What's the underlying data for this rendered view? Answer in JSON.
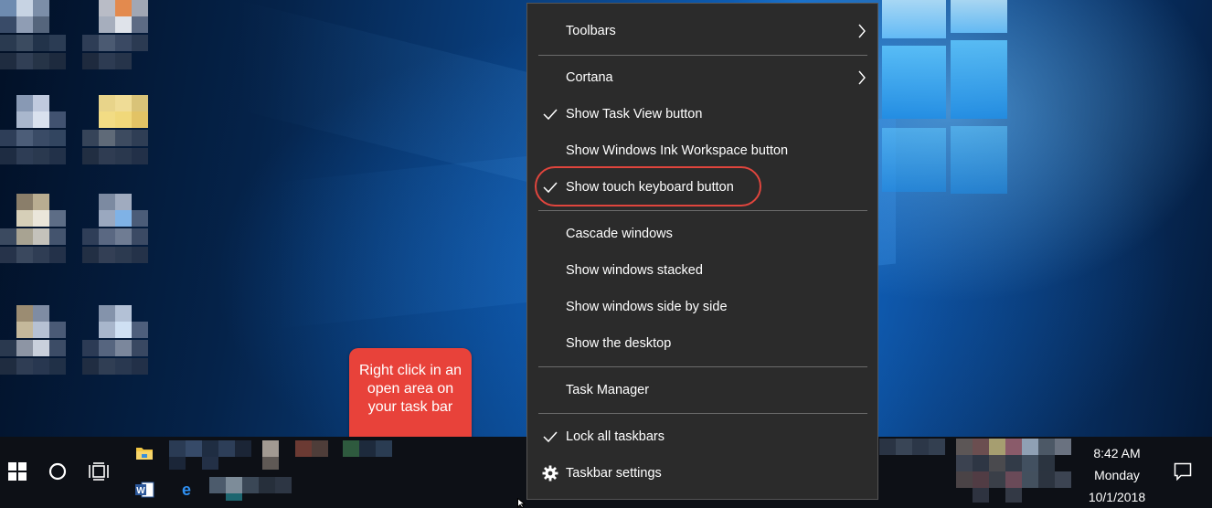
{
  "context_menu": {
    "toolbars": "Toolbars",
    "cortana": "Cortana",
    "show_task_view": "Show Task View button",
    "show_ink_workspace": "Show Windows Ink Workspace button",
    "show_touch_keyboard": "Show touch keyboard button",
    "cascade": "Cascade windows",
    "stacked": "Show windows stacked",
    "side_by_side": "Show windows side by side",
    "show_desktop": "Show the desktop",
    "task_manager": "Task Manager",
    "lock_taskbars": "Lock all taskbars",
    "taskbar_settings": "Taskbar settings",
    "checked": [
      "Show Task View button",
      "Show touch keyboard button",
      "Lock all taskbars"
    ]
  },
  "callout": {
    "text": "Right click in an open area on your task bar"
  },
  "clock": {
    "time": "8:42 AM",
    "day": "Monday",
    "date": "10/1/2018"
  },
  "icons": {
    "start": "windows-logo-icon",
    "search": "cortana-circle-icon",
    "task_view": "task-view-icon",
    "file_explorer": "folder-icon",
    "word": "word-icon",
    "edge": "edge-icon",
    "action_center": "notification-icon",
    "settings": "gear-icon",
    "check": "checkmark-icon",
    "submenu": "chevron-right-icon"
  },
  "colors": {
    "highlight_ring": "#e0453d",
    "callout": "#e8423a",
    "menu_bg": "#2b2b2b",
    "taskbar_bg": "#0d1016"
  }
}
